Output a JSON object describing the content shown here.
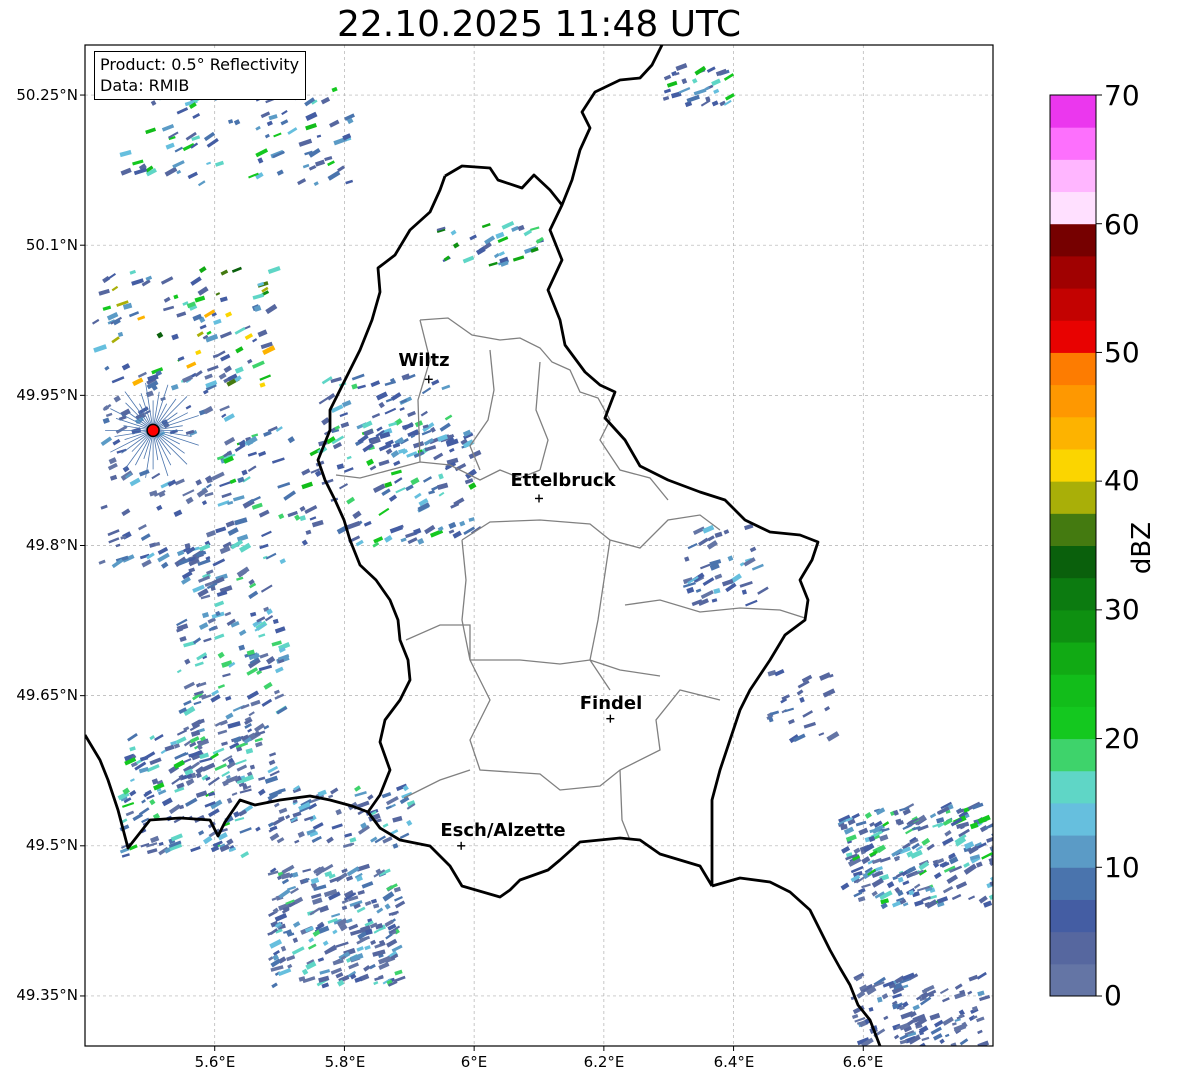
{
  "title": "22.10.2025 11:48 UTC",
  "info": {
    "product": "Product: 0.5° Reflectivity",
    "data_source": "Data: RMIB"
  },
  "axes": {
    "lat_labels": [
      "50.25°N",
      "50.1°N",
      "49.95°N",
      "49.8°N",
      "49.65°N",
      "49.5°N",
      "49.35°N"
    ],
    "lon_labels": [
      "5.6°E",
      "5.8°E",
      "6°E",
      "6.2°E",
      "6.4°E",
      "6.6°E"
    ],
    "lat_values": [
      50.25,
      50.1,
      49.95,
      49.8,
      49.65,
      49.5,
      49.35
    ],
    "lon_values": [
      5.6,
      5.8,
      6.0,
      6.2,
      6.4,
      6.6
    ],
    "lat_range": [
      49.3,
      50.3
    ],
    "lon_range": [
      5.4,
      6.8
    ],
    "grid": true
  },
  "cities": [
    {
      "name": "Wiltz",
      "lon": 5.93,
      "lat": 49.966
    },
    {
      "name": "Ettelbruck",
      "lon": 6.1,
      "lat": 49.847
    },
    {
      "name": "Findel",
      "lon": 6.21,
      "lat": 49.627
    },
    {
      "name": "Esch/Alzette",
      "lon": 5.98,
      "lat": 49.5
    }
  ],
  "radar_site": {
    "lon": 5.505,
    "lat": 49.915,
    "marker_color": "#ff0000"
  },
  "colorbar": {
    "label": "dBZ",
    "min": 0,
    "max": 70,
    "step": 2.5,
    "ticks": [
      "70",
      "60",
      "50",
      "40",
      "30",
      "20",
      "10",
      "0"
    ],
    "colors": [
      "#6475a5",
      "#56679f",
      "#445da3",
      "#4a74ad",
      "#5b9bc6",
      "#66bfde",
      "#5fd6c6",
      "#3ed36b",
      "#14c81f",
      "#12bd1a",
      "#11aa14",
      "#0e9011",
      "#0c7b10",
      "#0a600c",
      "#447a10",
      "#a9af08",
      "#fbd500",
      "#fdb300",
      "#fe9801",
      "#fd7c01",
      "#e80201",
      "#c30201",
      "#a00101",
      "#760000",
      "#ffe0ff",
      "#ffb6ff",
      "#fd70fd",
      "#eb37ee"
    ]
  },
  "echo_clusters": [
    {
      "lon": 5.63,
      "lat": 50.21,
      "dlon": 0.18,
      "dlat": 0.05,
      "n": 90,
      "intensity": [
        4,
        24
      ]
    },
    {
      "lon": 5.55,
      "lat": 50.02,
      "dlon": 0.14,
      "dlat": 0.06,
      "n": 90,
      "intensity": [
        4,
        46
      ]
    },
    {
      "lon": 5.52,
      "lat": 49.88,
      "dlon": 0.1,
      "dlat": 0.1,
      "n": 120,
      "intensity": [
        2,
        14
      ]
    },
    {
      "lon": 5.8,
      "lat": 49.86,
      "dlon": 0.2,
      "dlat": 0.06,
      "n": 160,
      "intensity": [
        4,
        24
      ]
    },
    {
      "lon": 5.86,
      "lat": 49.93,
      "dlon": 0.1,
      "dlat": 0.04,
      "n": 60,
      "intensity": [
        4,
        20
      ]
    },
    {
      "lon": 5.62,
      "lat": 49.68,
      "dlon": 0.08,
      "dlat": 0.12,
      "n": 180,
      "intensity": [
        2,
        20
      ]
    },
    {
      "lon": 5.55,
      "lat": 49.55,
      "dlon": 0.1,
      "dlat": 0.06,
      "n": 140,
      "intensity": [
        2,
        22
      ]
    },
    {
      "lon": 5.78,
      "lat": 49.42,
      "dlon": 0.1,
      "dlat": 0.06,
      "n": 200,
      "intensity": [
        2,
        20
      ]
    },
    {
      "lon": 5.78,
      "lat": 49.53,
      "dlon": 0.12,
      "dlat": 0.03,
      "n": 80,
      "intensity": [
        2,
        18
      ]
    },
    {
      "lon": 6.68,
      "lat": 49.49,
      "dlon": 0.12,
      "dlat": 0.05,
      "n": 220,
      "intensity": [
        2,
        22
      ]
    },
    {
      "lon": 6.68,
      "lat": 49.33,
      "dlon": 0.1,
      "dlat": 0.04,
      "n": 120,
      "intensity": [
        2,
        12
      ]
    },
    {
      "lon": 6.38,
      "lat": 49.78,
      "dlon": 0.06,
      "dlat": 0.04,
      "n": 40,
      "intensity": [
        2,
        14
      ]
    },
    {
      "lon": 6.34,
      "lat": 50.26,
      "dlon": 0.05,
      "dlat": 0.02,
      "n": 30,
      "intensity": [
        4,
        24
      ]
    },
    {
      "lon": 6.02,
      "lat": 50.1,
      "dlon": 0.08,
      "dlat": 0.02,
      "n": 30,
      "intensity": [
        4,
        34
      ]
    },
    {
      "lon": 6.5,
      "lat": 49.64,
      "dlon": 0.05,
      "dlat": 0.04,
      "n": 25,
      "intensity": [
        2,
        10
      ]
    }
  ]
}
